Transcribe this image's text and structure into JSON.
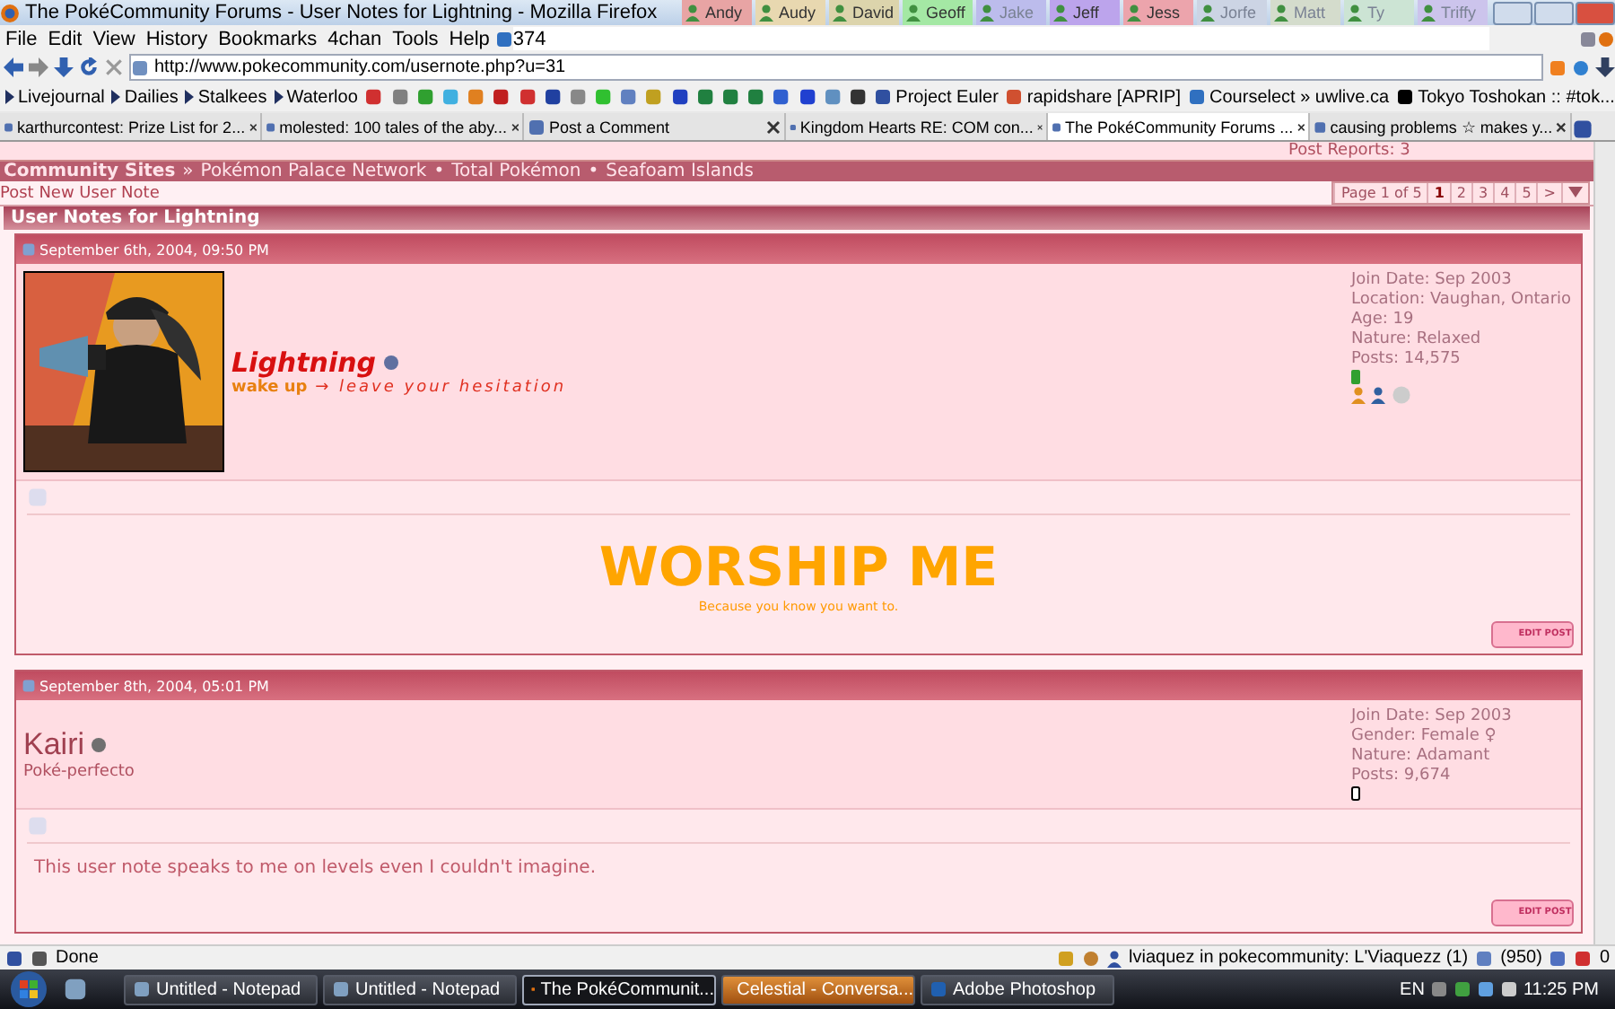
{
  "window": {
    "title": "The PokéCommunity Forums - User Notes for Lightning - Mozilla Firefox"
  },
  "user_tabs": [
    {
      "label": "Andy",
      "color": "#e8a4a4",
      "online": true
    },
    {
      "label": "Audy",
      "color": "#e8d8b0",
      "online": true
    },
    {
      "label": "David",
      "color": "#dcd4ac",
      "online": true
    },
    {
      "label": "Geoff",
      "color": "#a4e8a4",
      "online": true
    },
    {
      "label": "Jake",
      "color": "#bcbcec",
      "online": false
    },
    {
      "label": "Jeff",
      "color": "#bca4ec",
      "online": true
    },
    {
      "label": "Jess",
      "color": "#eca4ac",
      "online": true
    },
    {
      "label": "Jorfe",
      "color": "#ccd4e4",
      "online": false
    },
    {
      "label": "Matt",
      "color": "#d4dccc",
      "online": false
    },
    {
      "label": "Ty",
      "color": "#cce4d4",
      "online": false
    },
    {
      "label": "Triffy",
      "color": "#ccc4ec",
      "online": false
    }
  ],
  "menu": [
    "File",
    "Edit",
    "View",
    "History",
    "Bookmarks",
    "4chan",
    "Tools",
    "Help"
  ],
  "counter": "374",
  "url": "http://www.pokecommunity.com/usernote.php?u=31",
  "bookmark_folders": [
    "Livejournal",
    "Dailies",
    "Stalkees",
    "Waterloo"
  ],
  "bookmark_links": [
    "Project Euler",
    "rapidshare [APRIP]",
    "Courselect » uwlive.ca",
    "Tokyo Toshokan :: #tok..."
  ],
  "tabs": [
    {
      "label": "karthurcontest: Prize List for 2...",
      "selected": false
    },
    {
      "label": "molested: 100 tales of the aby...",
      "selected": false
    },
    {
      "label": "Post a Comment",
      "selected": false
    },
    {
      "label": "Kingdom Hearts RE: COM con...",
      "selected": false
    },
    {
      "label": "The PokéCommunity Forums ...",
      "selected": true
    },
    {
      "label": "causing problems ☆ makes y...",
      "selected": false
    }
  ],
  "post_reports": "Post Reports: 3",
  "nav_bar": {
    "title": "Community Sites",
    "separator": "»",
    "links": [
      {
        "text": "Pokémon Palace Network"
      },
      {
        "prefix": "•",
        "text": "Total Pokémon"
      },
      {
        "prefix": "•",
        "text": "Seafoam Islands"
      }
    ]
  },
  "post_new": "Post New User Note",
  "pagination": {
    "label": "Page 1 of 5",
    "pages": [
      {
        "label": "1",
        "selected": true
      },
      {
        "label": "2",
        "selected": false
      },
      {
        "label": "3",
        "selected": false
      },
      {
        "label": "4",
        "selected": false
      },
      {
        "label": "5",
        "selected": false
      }
    ],
    "next": ">"
  },
  "section_title": "User Notes for Lightning",
  "notes": [
    {
      "date": "September 6th, 2004, 09:50 PM",
      "avatar": {
        "kind": "picture"
      },
      "kind": "styled",
      "username": "Lightning",
      "subtitle": "**wake up** → *leave your hesitation*",
      "stats": [
        "Join Date: Sep 2003",
        "Location: Vaughan, Ontario",
        "Age: 19",
        "Nature: Relaxed",
        "Posts: 14,575"
      ],
      "online": true,
      "message": "WORSHIP ME",
      "submessage": "Because you know you want to.",
      "edit_label": "EDIT POST"
    },
    {
      "date": "September 8th, 2004, 05:01 PM",
      "kind": "plain",
      "username": "Kairi",
      "subtitle": "Poké-perfecto",
      "stats": [
        "Join Date: Sep 2003",
        "Gender: Female ♀",
        "Nature: Adamant",
        "Posts: 9,674"
      ],
      "online": false,
      "message": "This user note speaks to me on levels even I couldn't imagine.",
      "edit_label": "EDIT POST"
    }
  ],
  "status": {
    "text": "Done",
    "chat": "lviaquez in pokecommunity: L'Viaquezz (1)",
    "mail": "(950)",
    "gmail": "0"
  },
  "taskbar": [
    {
      "label": "Untitled - Notepad",
      "selected": false
    },
    {
      "label": "Untitled - Notepad",
      "selected": false
    },
    {
      "label": "The PokéCommunit...",
      "selected": true
    },
    {
      "label": "Celestial - Conversa...",
      "selected": false,
      "flashing": true
    },
    {
      "label": "Adobe Photoshop",
      "selected": false
    }
  ],
  "language": "EN",
  "clock": "11:25 PM"
}
